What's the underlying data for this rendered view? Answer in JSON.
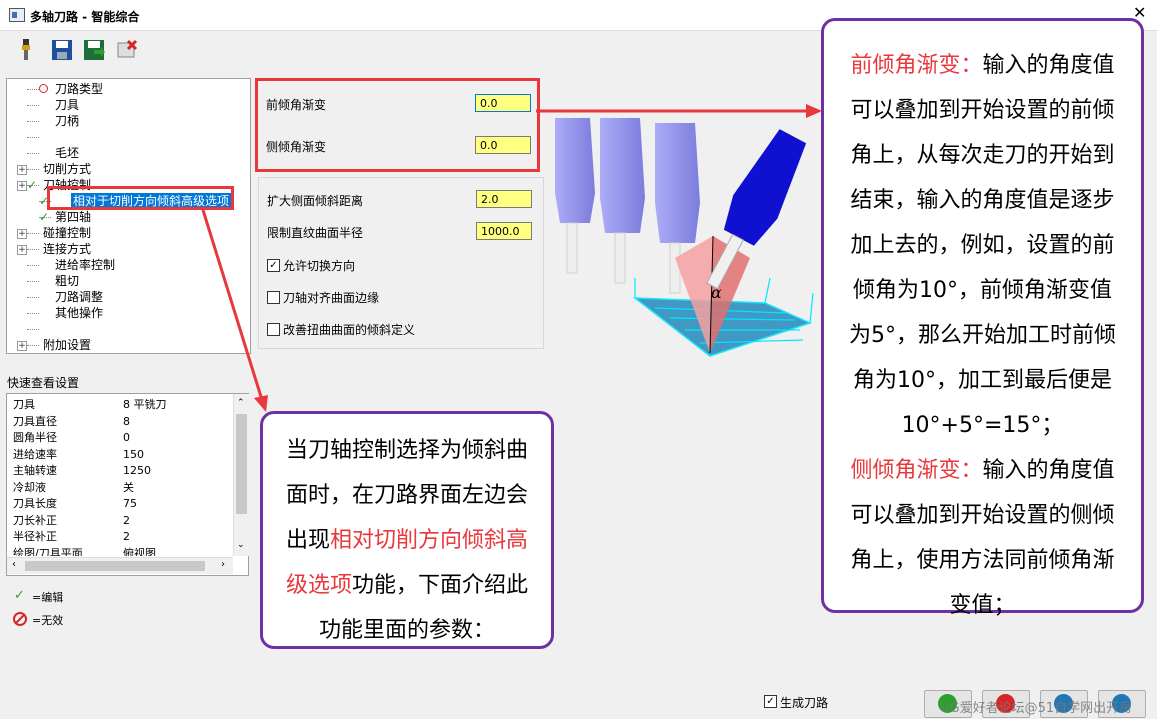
{
  "window": {
    "title": "多轴刀路 - 智能综合"
  },
  "toolbar": {
    "icons": [
      "tool-holder-icon",
      "save-icon",
      "save-export-icon",
      "delete-icon"
    ]
  },
  "tree": {
    "items": [
      {
        "label": "刀路类型",
        "icon": "invalid-icon"
      },
      {
        "label": "刀具"
      },
      {
        "label": "刀柄"
      },
      {
        "label": ""
      },
      {
        "label": "毛坯"
      },
      {
        "label": "切削方式",
        "expandable": true
      },
      {
        "label": "刀轴控制",
        "expandable": true,
        "icon": "check-icon"
      },
      {
        "label": "相对于切削方向倾斜高级选项",
        "icon": "check-icon",
        "selected": true
      },
      {
        "label": "第四轴",
        "icon": "check-icon"
      },
      {
        "label": "碰撞控制",
        "expandable": true
      },
      {
        "label": "连接方式",
        "expandable": true
      },
      {
        "label": "进给率控制"
      },
      {
        "label": "粗切"
      },
      {
        "label": "刀路调整"
      },
      {
        "label": "其他操作"
      },
      {
        "label": ""
      },
      {
        "label": "附加设置",
        "expandable": true
      }
    ]
  },
  "form": {
    "lead_angle_label": "前倾角渐变",
    "lead_angle_value": "0.0",
    "side_angle_label": "侧倾角渐变",
    "side_angle_value": "0.0",
    "extend_label": "扩大侧面倾斜距离",
    "extend_value": "2.0",
    "limit_label": "限制直纹曲面半径",
    "limit_value": "1000.0",
    "allow_switch_label": "允许切换方向",
    "allow_switch_checked": true,
    "align_edge_label": "刀轴对齐曲面边缘",
    "align_edge_checked": false,
    "improve_label": "改善扭曲曲面的倾斜定义",
    "improve_checked": false
  },
  "quick_view": {
    "title": "快速查看设置",
    "rows": [
      {
        "name": "刀具",
        "value": "8 平铣刀"
      },
      {
        "name": "刀具直径",
        "value": "8"
      },
      {
        "name": "圆角半径",
        "value": "0"
      },
      {
        "name": "进给速率",
        "value": "150"
      },
      {
        "name": "主轴转速",
        "value": "1250"
      },
      {
        "name": "冷却液",
        "value": "关"
      },
      {
        "name": "刀具长度",
        "value": "75"
      },
      {
        "name": "刀长补正",
        "value": "2"
      },
      {
        "name": "半径补正",
        "value": "2"
      },
      {
        "name": "绘图/刀具平面",
        "value": "俯视图"
      }
    ]
  },
  "legend": {
    "edited": "=编辑",
    "invalid": "=无效"
  },
  "footer": {
    "generate_label": "生成刀路",
    "generate_checked": true,
    "watermark": "UG爱好者论坛@51自学网出开房"
  },
  "callout_left": {
    "line1": "当刀轴控制选择为倾斜曲",
    "line2": "面时，在刀路界面左边会",
    "line3a": "出现",
    "line3b": "相对切削方向倾斜高",
    "line4a": "级选项",
    "line4b": "功能，下面介绍此",
    "line5": "功能里面的参数："
  },
  "callout_right": {
    "l1a": "前倾角渐变：",
    "l1b": "输入的角度值",
    "l2": "可以叠加到开始设置的前倾",
    "l3": "角上，从每次走刀的开始到",
    "l4": "结束，输入的角度值是逐步",
    "l5": "加上去的，例如，设置的前",
    "l6": "倾角为10°，前倾角渐变值",
    "l7": "为5°，那么开始加工时前倾",
    "l8": "角为10°，加工到最后便是",
    "l9": "10°+5°=15°；",
    "l10a": "侧倾角渐变：",
    "l10b": "输入的角度值",
    "l11": "可以叠加到开始设置的侧倾",
    "l12": "角上，使用方法同前倾角渐",
    "l13": "变值；"
  },
  "diagram": {
    "angle_symbol": "α"
  },
  "colors": {
    "callout_border": "#7030a0",
    "highlight_border": "#e8383c",
    "input_bg": "#ffff80",
    "selection": "#0078d7"
  }
}
